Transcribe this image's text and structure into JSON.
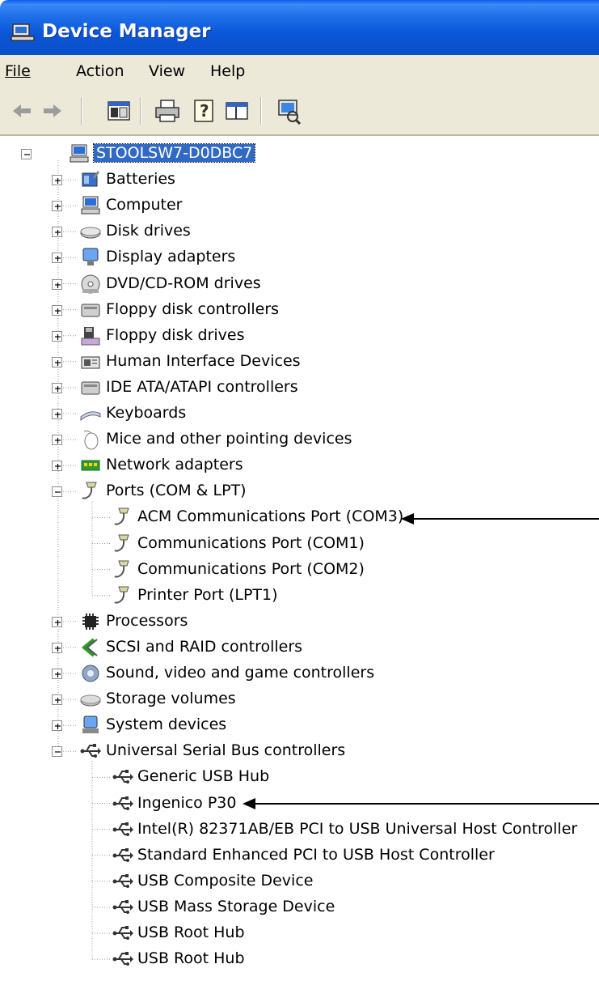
{
  "window": {
    "title": "Device Manager",
    "title_icon": "computer-icon"
  },
  "menu": [
    "File",
    "Action",
    "View",
    "Help"
  ],
  "toolbar": {
    "buttons": [
      "back-arrow-icon",
      "forward-arrow-icon",
      "properties-console-icon",
      "print-icon",
      "help-icon",
      "properties-icon",
      "scan-hardware-icon"
    ]
  },
  "tree": {
    "root": "STOOLSW7-D0DBC7",
    "categories": [
      {
        "label": "Batteries",
        "icon": "battery-icon"
      },
      {
        "label": "Computer",
        "icon": "computer-icon"
      },
      {
        "label": "Disk drives",
        "icon": "disk-drive-icon"
      },
      {
        "label": "Display adapters",
        "icon": "monitor-icon"
      },
      {
        "label": "DVD/CD-ROM drives",
        "icon": "cdrom-icon"
      },
      {
        "label": "Floppy disk controllers",
        "icon": "controller-icon"
      },
      {
        "label": "Floppy disk drives",
        "icon": "floppy-icon"
      },
      {
        "label": "Human Interface Devices",
        "icon": "hid-icon"
      },
      {
        "label": "IDE ATA/ATAPI controllers",
        "icon": "controller-icon"
      },
      {
        "label": "Keyboards",
        "icon": "keyboard-icon"
      },
      {
        "label": "Mice and other pointing devices",
        "icon": "mouse-icon"
      },
      {
        "label": "Network adapters",
        "icon": "network-card-icon"
      },
      {
        "label": "Ports (COM & LPT)",
        "icon": "port-icon"
      },
      {
        "label": "ACM Communications Port (COM3)",
        "icon": "port-icon"
      },
      {
        "label": "Communications Port (COM1)",
        "icon": "port-icon"
      },
      {
        "label": "Communications Port (COM2)",
        "icon": "port-icon"
      },
      {
        "label": "Printer Port (LPT1)",
        "icon": "port-icon"
      },
      {
        "label": "Processors",
        "icon": "processor-icon"
      },
      {
        "label": "SCSI and RAID controllers",
        "icon": "scsi-icon"
      },
      {
        "label": "Sound, video and game controllers",
        "icon": "speaker-icon"
      },
      {
        "label": "Storage volumes",
        "icon": "storage-icon"
      },
      {
        "label": "System devices",
        "icon": "system-device-icon"
      },
      {
        "label": "Universal Serial Bus controllers",
        "icon": "usb-icon"
      },
      {
        "label": "Generic USB Hub",
        "icon": "usb-icon"
      },
      {
        "label": "Ingenico P30",
        "icon": "usb-icon"
      },
      {
        "label": "Intel(R) 82371AB/EB PCI to USB Universal Host Controller",
        "icon": "usb-icon"
      },
      {
        "label": "Standard Enhanced PCI to USB Host Controller",
        "icon": "usb-icon"
      },
      {
        "label": "USB Composite Device",
        "icon": "usb-icon"
      },
      {
        "label": "USB Mass Storage Device",
        "icon": "usb-icon"
      },
      {
        "label": "USB Root Hub",
        "icon": "usb-icon"
      },
      {
        "label": "USB Root Hub",
        "icon": "usb-icon"
      }
    ]
  },
  "colors": {
    "titlebar": "#0b57d8",
    "selection": "#316ac5",
    "chrome": "#ece9d8"
  }
}
